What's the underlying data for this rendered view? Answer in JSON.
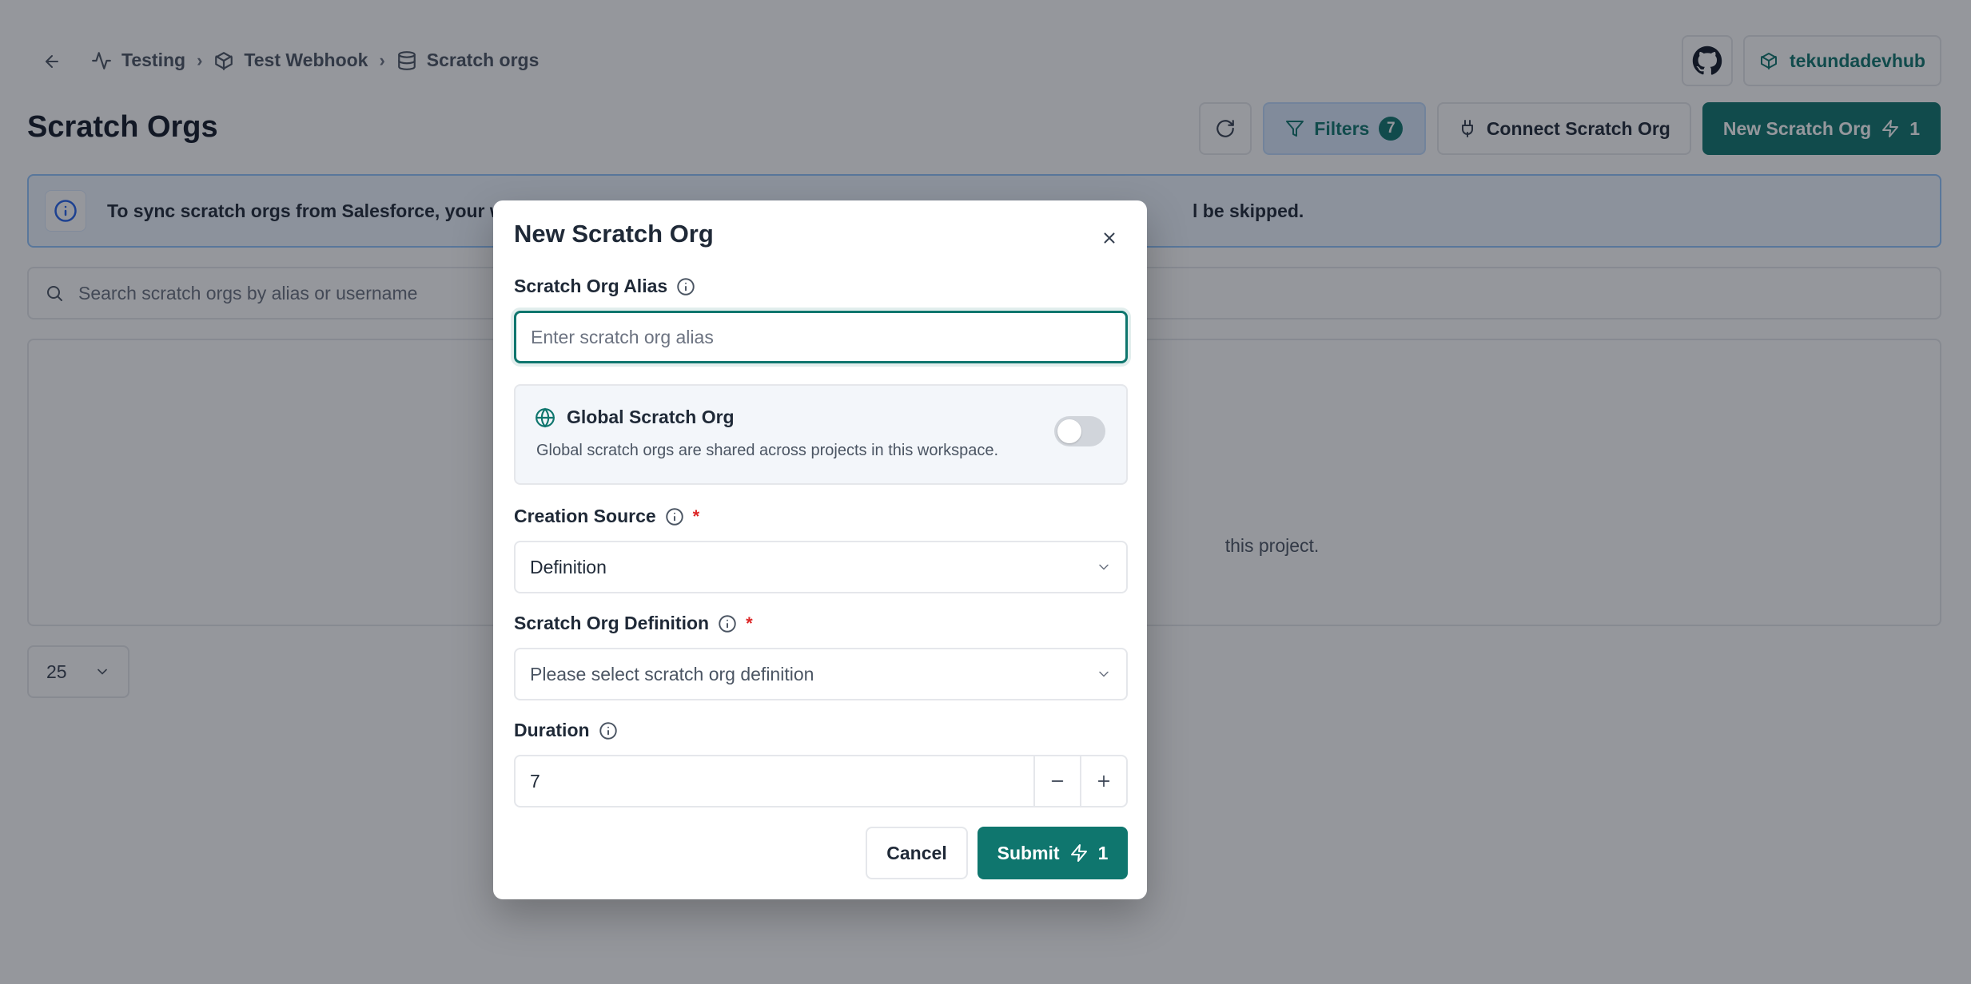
{
  "colors": {
    "accent": "#0f766e",
    "required": "#dc2626",
    "info": "#2563eb"
  },
  "header": {
    "breadcrumb": [
      {
        "label": "Testing",
        "icon": "activity-icon"
      },
      {
        "label": "Test Webhook",
        "icon": "package-icon"
      },
      {
        "label": "Scratch orgs",
        "icon": "database-icon"
      }
    ],
    "workspace_label": "tekundadevhub"
  },
  "page": {
    "title": "Scratch Orgs",
    "filters_label": "Filters",
    "filters_count": "7",
    "connect_label": "Connect Scratch Org",
    "new_label": "New Scratch Org",
    "new_credits": "1",
    "banner_text_start": "To sync scratch orgs from Salesforce, your wo",
    "banner_text_end": "l be skipped.",
    "search_placeholder": "Search scratch orgs by alias or username",
    "empty_text_fragment": "this project.",
    "page_size": "25"
  },
  "modal": {
    "title": "New Scratch Org",
    "alias_label": "Scratch Org Alias",
    "alias_placeholder": "Enter scratch org alias",
    "alias_value": "",
    "global_title": "Global Scratch Org",
    "global_desc": "Global scratch orgs are shared across projects in this workspace.",
    "global_enabled": false,
    "source_label": "Creation Source",
    "source_value": "Definition",
    "definition_label": "Scratch Org Definition",
    "definition_placeholder": "Please select scratch org definition",
    "required_mark": "*",
    "duration_label": "Duration",
    "duration_value": "7",
    "cancel_label": "Cancel",
    "submit_label": "Submit",
    "submit_credits": "1"
  }
}
